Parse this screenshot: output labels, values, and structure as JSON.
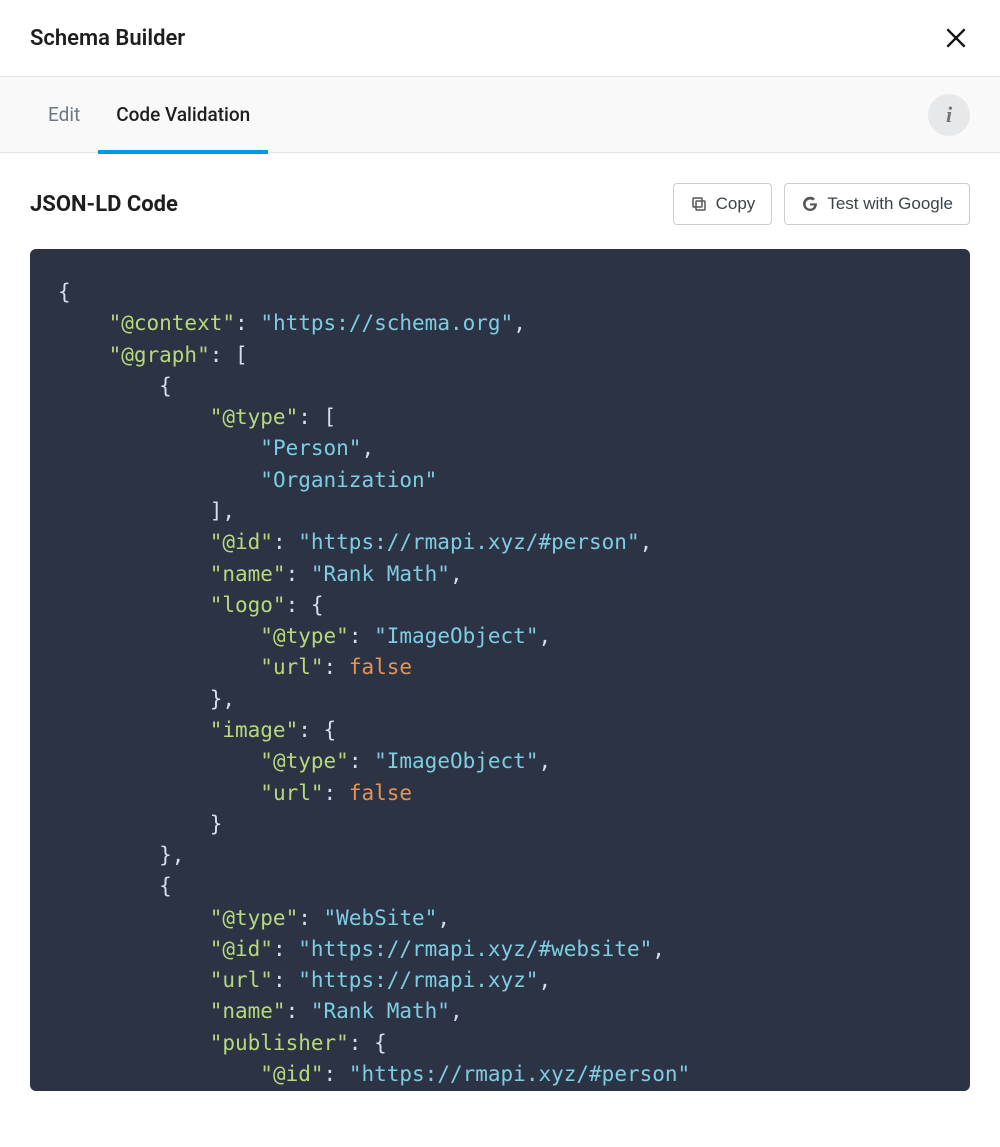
{
  "header": {
    "title": "Schema Builder"
  },
  "tabs": {
    "edit": "Edit",
    "code_validation": "Code Validation"
  },
  "section": {
    "title": "JSON-LD Code"
  },
  "buttons": {
    "copy": "Copy",
    "test_google": "Test with Google"
  },
  "code": {
    "lines": [
      {
        "segments": [
          {
            "cls": "tok-punc",
            "text": "{"
          }
        ]
      },
      {
        "segments": [
          {
            "cls": "tok-punc",
            "text": "    "
          },
          {
            "cls": "tok-key",
            "text": "\"@context\""
          },
          {
            "cls": "tok-punc",
            "text": ": "
          },
          {
            "cls": "tok-str",
            "text": "\"https://schema.org\""
          },
          {
            "cls": "tok-punc",
            "text": ","
          }
        ]
      },
      {
        "segments": [
          {
            "cls": "tok-punc",
            "text": "    "
          },
          {
            "cls": "tok-key",
            "text": "\"@graph\""
          },
          {
            "cls": "tok-punc",
            "text": ": ["
          }
        ]
      },
      {
        "segments": [
          {
            "cls": "tok-punc",
            "text": "        {"
          }
        ]
      },
      {
        "segments": [
          {
            "cls": "tok-punc",
            "text": "            "
          },
          {
            "cls": "tok-key",
            "text": "\"@type\""
          },
          {
            "cls": "tok-punc",
            "text": ": ["
          }
        ]
      },
      {
        "segments": [
          {
            "cls": "tok-punc",
            "text": "                "
          },
          {
            "cls": "tok-str",
            "text": "\"Person\""
          },
          {
            "cls": "tok-punc",
            "text": ","
          }
        ]
      },
      {
        "segments": [
          {
            "cls": "tok-punc",
            "text": "                "
          },
          {
            "cls": "tok-str",
            "text": "\"Organization\""
          }
        ]
      },
      {
        "segments": [
          {
            "cls": "tok-punc",
            "text": "            ],"
          }
        ]
      },
      {
        "segments": [
          {
            "cls": "tok-punc",
            "text": "            "
          },
          {
            "cls": "tok-key",
            "text": "\"@id\""
          },
          {
            "cls": "tok-punc",
            "text": ": "
          },
          {
            "cls": "tok-str",
            "text": "\"https://rmapi.xyz/#person\""
          },
          {
            "cls": "tok-punc",
            "text": ","
          }
        ]
      },
      {
        "segments": [
          {
            "cls": "tok-punc",
            "text": "            "
          },
          {
            "cls": "tok-key",
            "text": "\"name\""
          },
          {
            "cls": "tok-punc",
            "text": ": "
          },
          {
            "cls": "tok-str",
            "text": "\"Rank Math\""
          },
          {
            "cls": "tok-punc",
            "text": ","
          }
        ]
      },
      {
        "segments": [
          {
            "cls": "tok-punc",
            "text": "            "
          },
          {
            "cls": "tok-key",
            "text": "\"logo\""
          },
          {
            "cls": "tok-punc",
            "text": ": {"
          }
        ]
      },
      {
        "segments": [
          {
            "cls": "tok-punc",
            "text": "                "
          },
          {
            "cls": "tok-key",
            "text": "\"@type\""
          },
          {
            "cls": "tok-punc",
            "text": ": "
          },
          {
            "cls": "tok-str",
            "text": "\"ImageObject\""
          },
          {
            "cls": "tok-punc",
            "text": ","
          }
        ]
      },
      {
        "segments": [
          {
            "cls": "tok-punc",
            "text": "                "
          },
          {
            "cls": "tok-key",
            "text": "\"url\""
          },
          {
            "cls": "tok-punc",
            "text": ": "
          },
          {
            "cls": "tok-bool",
            "text": "false"
          }
        ]
      },
      {
        "segments": [
          {
            "cls": "tok-punc",
            "text": "            },"
          }
        ]
      },
      {
        "segments": [
          {
            "cls": "tok-punc",
            "text": "            "
          },
          {
            "cls": "tok-key",
            "text": "\"image\""
          },
          {
            "cls": "tok-punc",
            "text": ": {"
          }
        ]
      },
      {
        "segments": [
          {
            "cls": "tok-punc",
            "text": "                "
          },
          {
            "cls": "tok-key",
            "text": "\"@type\""
          },
          {
            "cls": "tok-punc",
            "text": ": "
          },
          {
            "cls": "tok-str",
            "text": "\"ImageObject\""
          },
          {
            "cls": "tok-punc",
            "text": ","
          }
        ]
      },
      {
        "segments": [
          {
            "cls": "tok-punc",
            "text": "                "
          },
          {
            "cls": "tok-key",
            "text": "\"url\""
          },
          {
            "cls": "tok-punc",
            "text": ": "
          },
          {
            "cls": "tok-bool",
            "text": "false"
          }
        ]
      },
      {
        "segments": [
          {
            "cls": "tok-punc",
            "text": "            }"
          }
        ]
      },
      {
        "segments": [
          {
            "cls": "tok-punc",
            "text": "        },"
          }
        ]
      },
      {
        "segments": [
          {
            "cls": "tok-punc",
            "text": "        {"
          }
        ]
      },
      {
        "segments": [
          {
            "cls": "tok-punc",
            "text": "            "
          },
          {
            "cls": "tok-key",
            "text": "\"@type\""
          },
          {
            "cls": "tok-punc",
            "text": ": "
          },
          {
            "cls": "tok-str",
            "text": "\"WebSite\""
          },
          {
            "cls": "tok-punc",
            "text": ","
          }
        ]
      },
      {
        "segments": [
          {
            "cls": "tok-punc",
            "text": "            "
          },
          {
            "cls": "tok-key",
            "text": "\"@id\""
          },
          {
            "cls": "tok-punc",
            "text": ": "
          },
          {
            "cls": "tok-str",
            "text": "\"https://rmapi.xyz/#website\""
          },
          {
            "cls": "tok-punc",
            "text": ","
          }
        ]
      },
      {
        "segments": [
          {
            "cls": "tok-punc",
            "text": "            "
          },
          {
            "cls": "tok-key",
            "text": "\"url\""
          },
          {
            "cls": "tok-punc",
            "text": ": "
          },
          {
            "cls": "tok-str",
            "text": "\"https://rmapi.xyz\""
          },
          {
            "cls": "tok-punc",
            "text": ","
          }
        ]
      },
      {
        "segments": [
          {
            "cls": "tok-punc",
            "text": "            "
          },
          {
            "cls": "tok-key",
            "text": "\"name\""
          },
          {
            "cls": "tok-punc",
            "text": ": "
          },
          {
            "cls": "tok-str",
            "text": "\"Rank Math\""
          },
          {
            "cls": "tok-punc",
            "text": ","
          }
        ]
      },
      {
        "segments": [
          {
            "cls": "tok-punc",
            "text": "            "
          },
          {
            "cls": "tok-key",
            "text": "\"publisher\""
          },
          {
            "cls": "tok-punc",
            "text": ": {"
          }
        ]
      },
      {
        "segments": [
          {
            "cls": "tok-punc",
            "text": "                "
          },
          {
            "cls": "tok-key",
            "text": "\"@id\""
          },
          {
            "cls": "tok-punc",
            "text": ": "
          },
          {
            "cls": "tok-str",
            "text": "\"https://rmapi.xyz/#person\""
          }
        ]
      }
    ]
  }
}
